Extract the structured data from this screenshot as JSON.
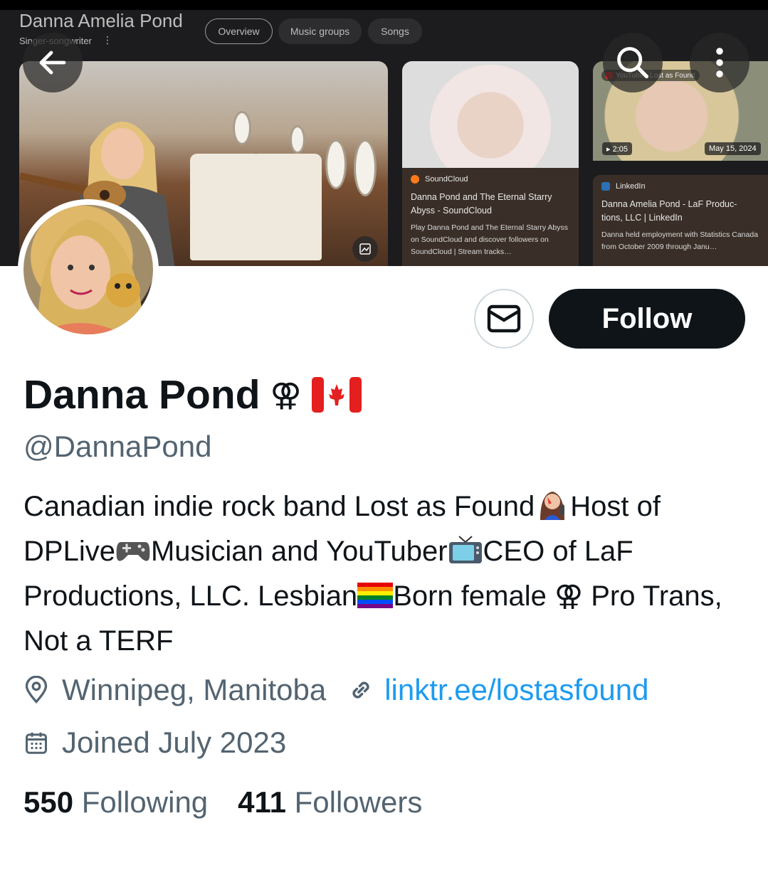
{
  "banner": {
    "panel_title": "Danna Amelia Pond",
    "panel_subtitle": "Singer-songwriter",
    "chips": [
      {
        "label": "Overview",
        "active": true
      },
      {
        "label": "Music groups",
        "active": false
      },
      {
        "label": "Songs",
        "active": false
      }
    ],
    "card_soundcloud": {
      "source": "SoundCloud",
      "title": "Danna Pond and The Eternal Starry Abyss - SoundCloud",
      "snippet": "Play Danna Pond and The Eternal Starry Abyss on SoundCloud and discover followers on SoundCloud | Stream tracks…"
    },
    "card_linkedin": {
      "source": "LinkedIn",
      "title": "Danna Amelia Pond - LaF Produc- tions, LLC | LinkedIn",
      "snippet": "Danna held employment with Statistics Canada from October 2009 through Janu…"
    },
    "video_duration": "▸ 2:05",
    "video_date": "May 15, 2024",
    "video_label": "YouTube · Lost as Found"
  },
  "profile": {
    "name": "Danna Pond",
    "handle": "@DannaPond",
    "follow_label": "Follow",
    "bio_parts": [
      "Canadian indie rock band Lost as Found",
      "Host of DPLive",
      "Musician and YouTuber",
      "CEO of LaF Productions, LLC. Lesbian",
      "Born female ⚢ Pro Trans, Not a TERF"
    ],
    "location": "Winnipeg, Manitoba",
    "website": "linktr.ee/lostasfound",
    "joined": "Joined July 2023",
    "following_count": "550",
    "following_label": "Following",
    "followers_count": "411",
    "followers_label": "Followers"
  },
  "icons": {
    "back": "arrow-left-icon",
    "search": "search-icon",
    "more": "more-vertical-icon",
    "message": "envelope-icon",
    "location": "location-pin-icon",
    "link": "link-icon",
    "calendar": "calendar-icon"
  }
}
